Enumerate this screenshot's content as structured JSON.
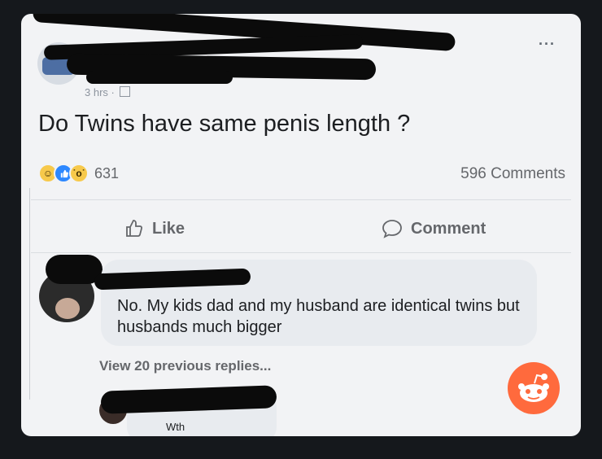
{
  "post": {
    "timestamp": "3 hrs ·",
    "more_label": "···",
    "text": "Do Twins have same penis length ?",
    "reaction_count": "631",
    "comment_count": "596 Comments",
    "reaction_icons": [
      "haha-icon",
      "like-icon",
      "wow-icon"
    ]
  },
  "actions": {
    "like_label": "Like",
    "comment_label": "Comment"
  },
  "reply": {
    "text": "No. My kids dad and my husband are identical twins but husbands much bigger",
    "view_previous": "View 20 previous replies..."
  },
  "bottom_reply": {
    "partial_text": "Wth"
  },
  "colors": {
    "background": "#15181c",
    "card": "#f2f3f5",
    "bubble": "#e8ebef",
    "reddit": "#ff6a3d",
    "like_blue": "#2d88ff"
  }
}
